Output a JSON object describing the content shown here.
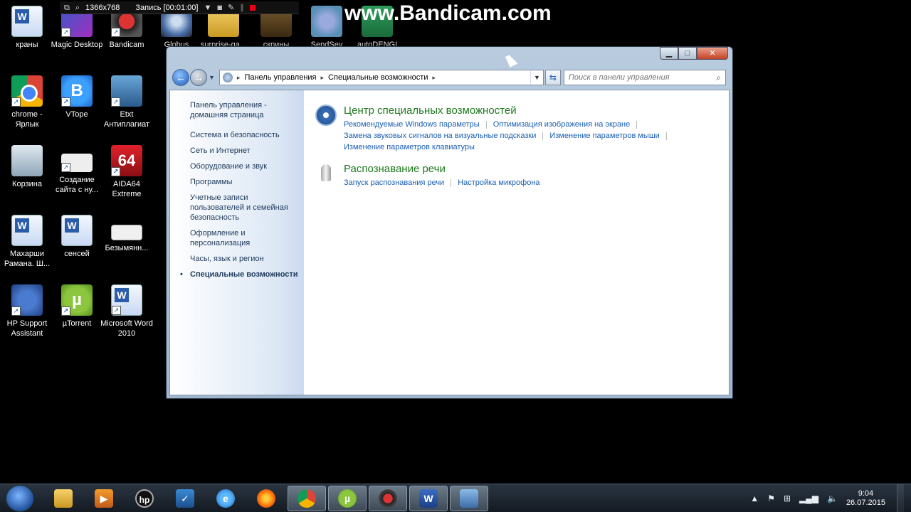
{
  "recorder": {
    "resolution": "1366x768",
    "recording": "Запись [00:01:00]",
    "watermark": "www.Bandicam.com"
  },
  "desktop_icons": [
    {
      "label": "краны",
      "icon": "word-doc-icon"
    },
    {
      "label": "Magic Desktop",
      "icon": "magic-desktop-icon"
    },
    {
      "label": "Bandicam",
      "icon": "bandicam-icon"
    },
    {
      "label": "Globus",
      "icon": "globus-icon"
    },
    {
      "label": "surprise-ga...",
      "icon": "folder-icon"
    },
    {
      "label": "скрины",
      "icon": "folder-icon"
    },
    {
      "label": "SendSev",
      "icon": "sendsev-icon"
    },
    {
      "label": "autoDENGI",
      "icon": "autodengi-icon"
    },
    {
      "label": "chrome - Ярлык",
      "icon": "chrome-icon"
    },
    {
      "label": "VTope",
      "icon": "vtope-icon"
    },
    {
      "label": "Etxt Антиплагиат",
      "icon": "etxt-icon"
    },
    {
      "label": "Корзина",
      "icon": "recycle-bin-icon"
    },
    {
      "label": "Создание сайта с ну...",
      "icon": "image-file-icon"
    },
    {
      "label": "AIDA64 Extreme",
      "icon": "aida64-icon"
    },
    {
      "label": "Махарши Рамана. Ш...",
      "icon": "word-doc-icon"
    },
    {
      "label": "сенсей",
      "icon": "word-doc-icon"
    },
    {
      "label": "Безымянн...",
      "icon": "image-file-icon"
    },
    {
      "label": "HP Support Assistant",
      "icon": "hp-support-icon"
    },
    {
      "label": "µTorrent",
      "icon": "utorrent-icon"
    },
    {
      "label": "Microsoft Word 2010",
      "icon": "word-icon"
    }
  ],
  "window": {
    "breadcrumb": [
      "Панель управления",
      "Специальные возможности"
    ],
    "search_placeholder": "Поиск в панели управления",
    "left_nav": {
      "home": "Панель управления - домашняя страница",
      "items": [
        "Система и безопасность",
        "Сеть и Интернет",
        "Оборудование и звук",
        "Программы",
        "Учетные записи пользователей и семейная безопасность",
        "Оформление и персонализация",
        "Часы, язык и регион"
      ],
      "current": "Специальные возможности"
    },
    "categories": [
      {
        "title": "Центр специальных возможностей",
        "icon": "ease-of-access-icon",
        "links": [
          "Рекомендуемые Windows параметры",
          "Оптимизация изображения на экране",
          "Замена звуковых сигналов на визуальные подсказки",
          "Изменение параметров мыши",
          "Изменение параметров клавиатуры"
        ]
      },
      {
        "title": "Распознавание речи",
        "icon": "microphone-icon",
        "links": [
          "Запуск распознавания речи",
          "Настройка микрофона"
        ]
      }
    ]
  },
  "taskbar": {
    "apps": [
      "explorer",
      "media-player",
      "hp",
      "checklist",
      "internet-explorer",
      "firefox",
      "chrome",
      "utorrent",
      "bandicam",
      "word",
      "control-panel"
    ],
    "time": "9:04",
    "date": "26.07.2015"
  }
}
